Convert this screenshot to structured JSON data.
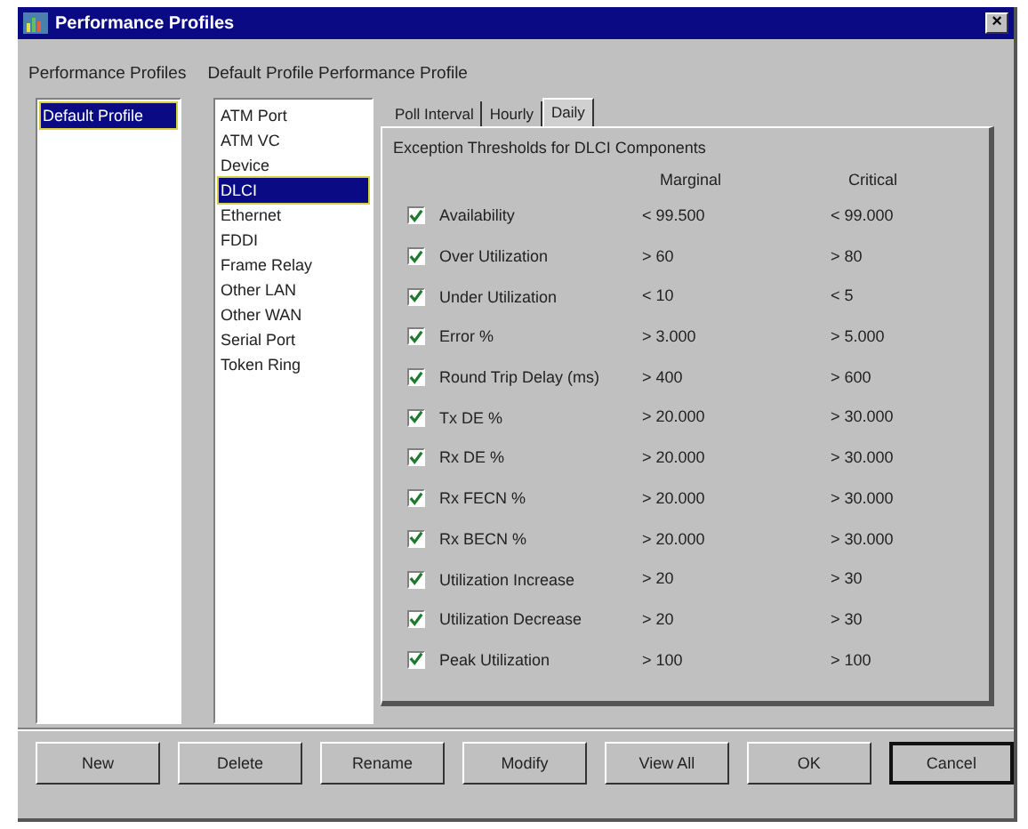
{
  "window": {
    "title": "Performance Profiles",
    "close": "×"
  },
  "headers": {
    "profiles": "Performance Profiles",
    "detail": "Default Profile Performance Profile"
  },
  "profiles": [
    {
      "label": "Default Profile",
      "selected": true
    }
  ],
  "components": [
    {
      "label": "ATM Port",
      "selected": false
    },
    {
      "label": "ATM VC",
      "selected": false
    },
    {
      "label": "Device",
      "selected": false
    },
    {
      "label": "DLCI",
      "selected": true
    },
    {
      "label": "Ethernet",
      "selected": false
    },
    {
      "label": "FDDI",
      "selected": false
    },
    {
      "label": "Frame Relay",
      "selected": false
    },
    {
      "label": "Other LAN",
      "selected": false
    },
    {
      "label": "Other WAN",
      "selected": false
    },
    {
      "label": "Serial Port",
      "selected": false
    },
    {
      "label": "Token Ring",
      "selected": false
    }
  ],
  "tabs": [
    {
      "label": "Poll Interval",
      "selected": false
    },
    {
      "label": "Hourly",
      "selected": false
    },
    {
      "label": "Daily",
      "selected": true
    }
  ],
  "panel": {
    "title": "Exception Thresholds for DLCI Components",
    "columns": [
      "Marginal",
      "Critical"
    ]
  },
  "thresholds": [
    {
      "name": "Availability",
      "checked": true,
      "marginal": "< 99.500",
      "critical": "< 99.000"
    },
    {
      "name": "Over Utilization",
      "checked": true,
      "marginal": "> 60",
      "critical": "> 80"
    },
    {
      "name": "Under Utilization",
      "checked": true,
      "marginal": "< 10",
      "critical": "< 5"
    },
    {
      "name": "Error %",
      "checked": true,
      "marginal": "> 3.000",
      "critical": "> 5.000"
    },
    {
      "name": "Round Trip Delay (ms)",
      "checked": true,
      "marginal": "> 400",
      "critical": "> 600"
    },
    {
      "name": "Tx DE %",
      "checked": true,
      "marginal": "> 20.000",
      "critical": "> 30.000"
    },
    {
      "name": "Rx DE %",
      "checked": true,
      "marginal": "> 20.000",
      "critical": "> 30.000"
    },
    {
      "name": "Rx FECN %",
      "checked": true,
      "marginal": "> 20.000",
      "critical": "> 30.000"
    },
    {
      "name": "Rx BECN %",
      "checked": true,
      "marginal": "> 20.000",
      "critical": "> 30.000"
    },
    {
      "name": "Utilization Increase",
      "checked": true,
      "marginal": "> 20",
      "critical": "> 30"
    },
    {
      "name": "Utilization Decrease",
      "checked": true,
      "marginal": "> 20",
      "critical": "> 30"
    },
    {
      "name": "Peak Utilization",
      "checked": true,
      "marginal": "> 100",
      "critical": "> 100"
    }
  ],
  "buttons": [
    {
      "label": "New",
      "default": false
    },
    {
      "label": "Delete",
      "default": false
    },
    {
      "label": "Rename",
      "default": false
    },
    {
      "label": "Modify",
      "default": false
    },
    {
      "label": "View All",
      "default": false
    },
    {
      "label": "OK",
      "default": false
    },
    {
      "label": "Cancel",
      "default": true
    }
  ]
}
